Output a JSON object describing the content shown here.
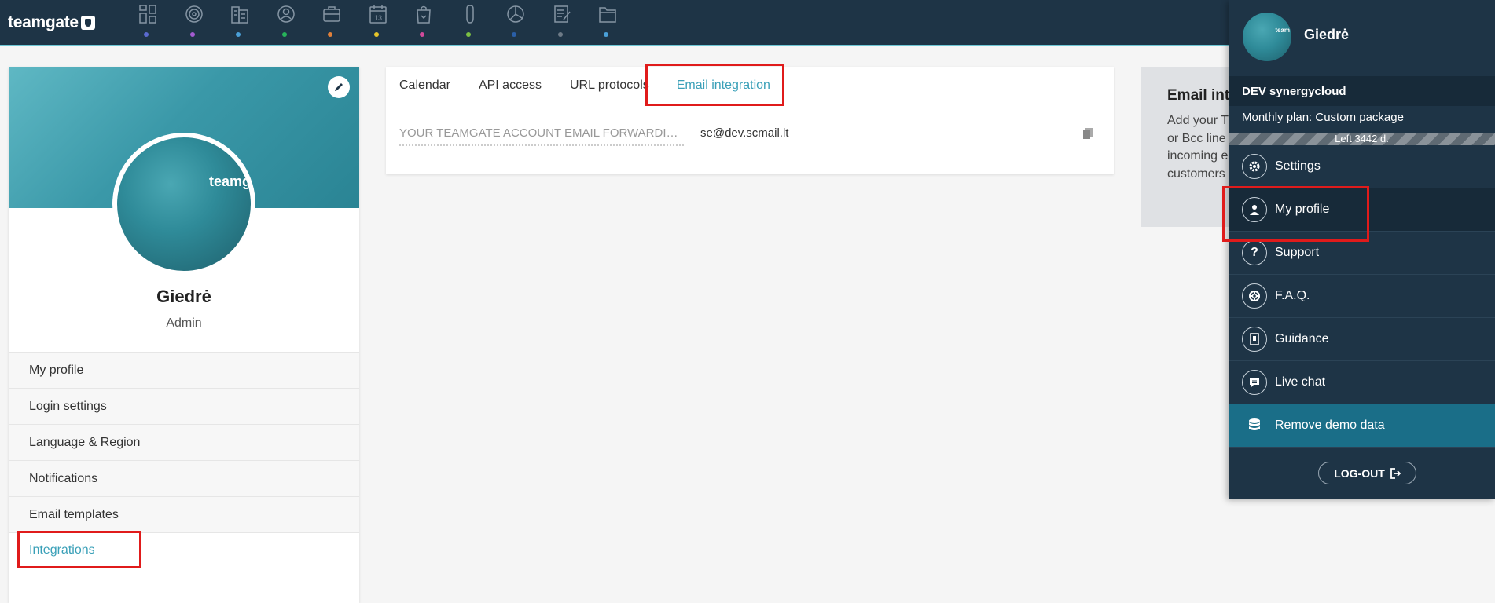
{
  "app": {
    "logo": "teamgate"
  },
  "nav": {
    "icons": [
      {
        "name": "dashboard-icon",
        "dot": "#5b6ad0"
      },
      {
        "name": "target-icon",
        "dot": "#a35bd0"
      },
      {
        "name": "companies-icon",
        "dot": "#4aa0d8"
      },
      {
        "name": "contacts-icon",
        "dot": "#27b35a"
      },
      {
        "name": "deals-icon",
        "dot": "#e0803a"
      },
      {
        "name": "calendar-icon",
        "dot": "#e6c52a"
      },
      {
        "name": "leads-icon",
        "dot": "#d04a9a"
      },
      {
        "name": "files-icon",
        "dot": "#7bc043"
      },
      {
        "name": "reports-icon",
        "dot": "#2a5fa8"
      },
      {
        "name": "notes-icon",
        "dot": "#6d7a86"
      },
      {
        "name": "folder-icon",
        "dot": "#4aa0d8"
      }
    ],
    "calendar_day": "13"
  },
  "profile": {
    "name": "Giedrė",
    "role": "Admin",
    "avatar_mark": "teamg",
    "menu": [
      "My profile",
      "Login settings",
      "Language & Region",
      "Notifications",
      "Email templates",
      "Integrations"
    ],
    "active_item": "Integrations"
  },
  "integrations": {
    "tabs": [
      "Calendar",
      "API access",
      "URL protocols",
      "Email integration"
    ],
    "active_tab": "Email integration",
    "forwarding_label": "YOUR TEAMGATE ACCOUNT EMAIL FORWARDING ADDRESS",
    "forwarding_value": "se@dev.scmail.lt"
  },
  "info_card": {
    "title": "Email int",
    "lines": [
      "Add your T",
      "or Bcc line",
      "incoming e",
      "customers"
    ]
  },
  "user_panel": {
    "name": "Giedrė",
    "avatar_mark": "team",
    "company": "DEV synergycloud",
    "plan": "Monthly plan: Custom package",
    "left_days": "Left 3442 d.",
    "menu": [
      {
        "label": "Settings",
        "icon": "gear-icon"
      },
      {
        "label": "My profile",
        "icon": "user-icon"
      },
      {
        "label": "Support",
        "icon": "question-icon"
      },
      {
        "label": "F.A.Q.",
        "icon": "lifebuoy-icon"
      },
      {
        "label": "Guidance",
        "icon": "guide-icon"
      },
      {
        "label": "Live chat",
        "icon": "chat-icon"
      },
      {
        "label": "Remove demo data",
        "icon": "database-icon"
      }
    ],
    "logout": "LOG-OUT"
  }
}
